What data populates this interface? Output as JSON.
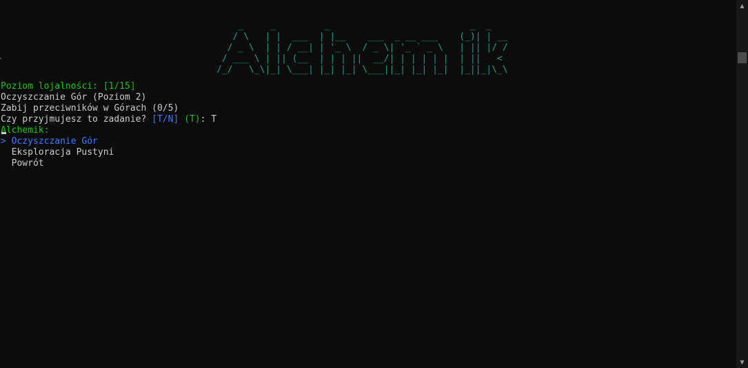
{
  "banner": {
    "lines": [
      "                                            _     _         _                          _  _    ",
      "                                           / \\   | |  ___  | |__    ___  _ __ ___    (_)| | __",
      "                                          / _ \\  | | / __| | '_ \\  / _ \\| '_ ` _ \\   | || |/ /",
      "                                         / ___ \\ | || (__  | | | ||  __/| | | | | |  | ||   < ",
      "                                        /_/   \\_\\|_| \\___| |_| |_| \\___||_| |_| |_|  |_||_|\\_\\"
    ],
    "color": "#13a18a"
  },
  "loyalty": {
    "label": "Poziom lojalności: [1/15]"
  },
  "quest": {
    "title": "Oczyszczanie Gór (Poziom 2)",
    "objective": "Zabij przeciwników w Górach (0/5)",
    "prompt": "Czy przyjmujesz to zadanie? ",
    "options_hint": "[T/N]",
    "default_hint": "(T)",
    "answer_sep": ": ",
    "answer": "T"
  },
  "npc": {
    "name": "Alchemik:"
  },
  "menu": {
    "selector": "> ",
    "unselected_marker": "  ",
    "items": [
      {
        "label": "Oczyszczanie Gór",
        "selected": true
      },
      {
        "label": "Eksploracja Pustyni",
        "selected": false
      },
      {
        "label": "Powrót",
        "selected": false
      }
    ]
  },
  "colors": {
    "background": "#0c0c0c",
    "foreground": "#cccccc",
    "green": "#16c60c",
    "aqua": "#13a18a",
    "blue": "#3b78ff"
  },
  "scrollbar": {
    "up_icon": "▲",
    "down_icon": "▼"
  }
}
